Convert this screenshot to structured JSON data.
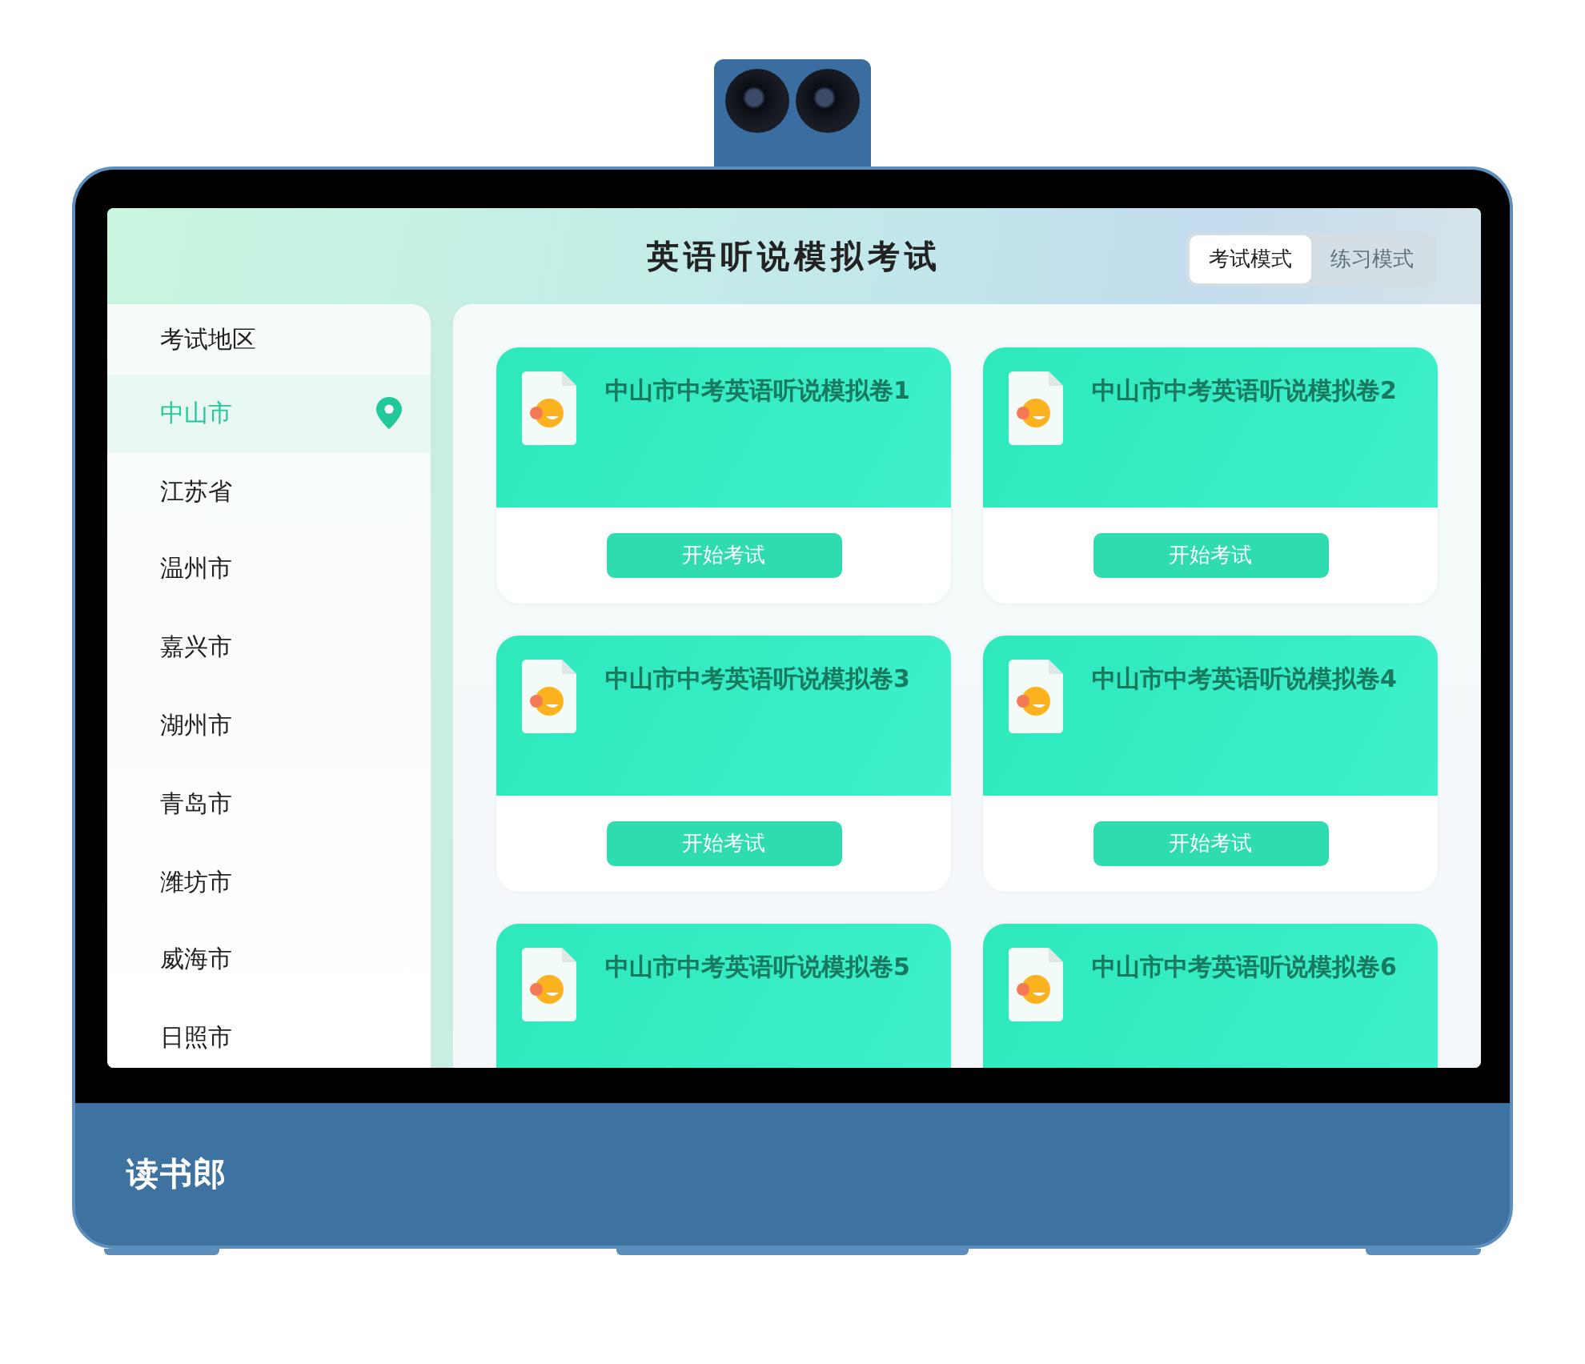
{
  "header": {
    "title": "英语听说模拟考试",
    "modes": [
      {
        "label": "考试模式",
        "selected": true
      },
      {
        "label": "练习模式",
        "selected": false
      }
    ]
  },
  "sidebar": {
    "heading": "考试地区",
    "items": [
      {
        "label": "中山市",
        "selected": true
      },
      {
        "label": "江苏省",
        "selected": false
      },
      {
        "label": "温州市",
        "selected": false
      },
      {
        "label": "嘉兴市",
        "selected": false
      },
      {
        "label": "湖州市",
        "selected": false
      },
      {
        "label": "青岛市",
        "selected": false
      },
      {
        "label": "潍坊市",
        "selected": false
      },
      {
        "label": "威海市",
        "selected": false
      },
      {
        "label": "日照市",
        "selected": false
      }
    ]
  },
  "papers": [
    {
      "title": "中山市中考英语听说模拟卷1",
      "button": "开始考试"
    },
    {
      "title": "中山市中考英语听说模拟卷2",
      "button": "开始考试"
    },
    {
      "title": "中山市中考英语听说模拟卷3",
      "button": "开始考试"
    },
    {
      "title": "中山市中考英语听说模拟卷4",
      "button": "开始考试"
    },
    {
      "title": "中山市中考英语听说模拟卷5"
    },
    {
      "title": "中山市中考英语听说模拟卷6"
    }
  ],
  "device": {
    "brand": "读书郎"
  }
}
